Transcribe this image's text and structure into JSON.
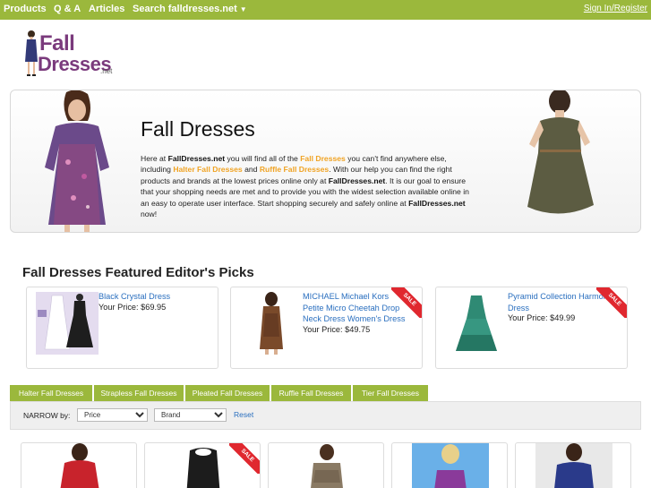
{
  "nav": {
    "items": [
      "Products",
      "Q & A",
      "Articles",
      "Search falldresses.net"
    ],
    "signin": "Sign In/Register"
  },
  "logo": {
    "line1": "Fall",
    "line2": "Dresses",
    "suffix": ".net"
  },
  "hero": {
    "title": "Fall Dresses",
    "desc": {
      "p1": "Here at ",
      "b1": "FallDresses.net",
      "p2": " you will find all of the ",
      "h1": "Fall Dresses",
      "p3": " you can't find anywhere else, including ",
      "h2": "Halter Fall Dresses",
      "p4": " and ",
      "h3": "Ruffle Fall Dresses",
      "p5": ". With our help you can find the right products and brands at the lowest prices online only at ",
      "b2": "FallDresses.net",
      "p6": ". It is our goal to ensure that your shopping needs are met and to provide you with the widest selection available online in an easy to operate user interface. Start shopping securely and safely online at ",
      "b3": "FallDresses.net",
      "p7": " now!"
    }
  },
  "picks": {
    "heading": "Fall Dresses Featured Editor's Picks",
    "items": [
      {
        "name": "Black Crystal Dress",
        "price": "Your Price: $69.95",
        "sale": false
      },
      {
        "name": "MICHAEL Michael Kors Petite Micro Cheetah Drop Neck Dress Women's Dress",
        "price": "Your Price: $49.75",
        "sale": true
      },
      {
        "name": "Pyramid Collection Harmony Dress",
        "price": "Your Price: $49.99",
        "sale": true
      }
    ],
    "sale_label": "SALE"
  },
  "tabs": [
    "Halter Fall Dresses",
    "Strapless Fall Dresses",
    "Pleated Fall Dresses",
    "Ruffle Fall Dresses",
    "Tier Fall Dresses"
  ],
  "filters": {
    "label": "NARROW by:",
    "price": "Price",
    "brand": "Brand",
    "reset": "Reset"
  },
  "colors": {
    "nav_green": "#9bb83c",
    "accent_orange": "#f0a323",
    "link_blue": "#2a6fbf",
    "sale_red": "#e0282f",
    "logo_purple": "#7a3a7c"
  }
}
